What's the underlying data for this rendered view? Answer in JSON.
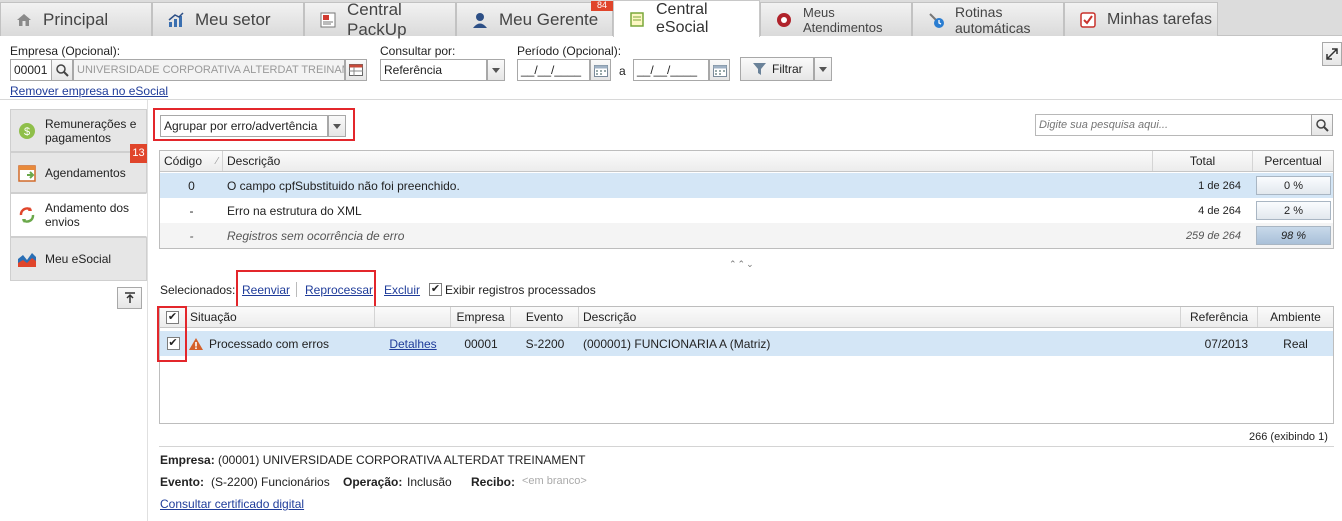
{
  "tabs": [
    {
      "label": "Principal",
      "icon": "home-icon"
    },
    {
      "label": "Meu setor",
      "icon": "chart-icon"
    },
    {
      "label": "Central PackUp",
      "icon": "document-icon"
    },
    {
      "label": "Meu Gerente",
      "icon": "user-icon",
      "badge": "84"
    },
    {
      "label": "Central eSocial",
      "icon": "note-icon",
      "active": true
    },
    {
      "label": "Meus Atendimentos",
      "icon": "support-icon"
    },
    {
      "label": "Rotinas automáticas",
      "icon": "gear-clock-icon"
    },
    {
      "label": "Minhas tarefas",
      "icon": "checklist-icon"
    }
  ],
  "filters": {
    "empresa_label": "Empresa (Opcional):",
    "empresa_code": "00001",
    "empresa_name": "UNIVERSIDADE CORPORATIVA ALTERDAT TREINAMENT",
    "consultar_label": "Consultar por:",
    "consultar_value": "Referência",
    "periodo_label": "Período (Opcional):",
    "periodo_from": "__/__/____",
    "periodo_sep": "a",
    "periodo_to": "__/__/____",
    "filtrar_label": "Filtrar",
    "remove_link": "Remover empresa no eSocial"
  },
  "sidebar": {
    "items": [
      {
        "label": "Remunerações e pagamentos",
        "icon": "money-icon"
      },
      {
        "label": "Agendamentos",
        "icon": "calendar-icon"
      },
      {
        "label": "Andamento dos envios",
        "icon": "sync-icon",
        "active": true
      },
      {
        "label": "Meu eSocial",
        "icon": "area-chart-icon"
      }
    ],
    "badge": "13"
  },
  "group": {
    "select_value": "Agrupar por erro/advertência",
    "search_placeholder": "Digite sua pesquisa aqui..."
  },
  "errors_table": {
    "headers": [
      "Código",
      "Descrição",
      "Total",
      "Percentual"
    ],
    "rows": [
      {
        "code": "0",
        "desc": "O campo cpfSubstituido não foi preenchido.",
        "total": "1 de 264",
        "pct": "0 %"
      },
      {
        "code": "-",
        "desc": "Erro na estrutura do XML",
        "total": "4 de 264",
        "pct": "2 %"
      },
      {
        "code": "-",
        "desc": "Registros sem ocorrência de erro",
        "total": "259 de 264",
        "pct": "98 %"
      }
    ]
  },
  "collapse_toggle": "⌃⌃⌄",
  "actions": {
    "selecionados": "Selecionados:",
    "reenviar": "Reenviar",
    "reprocessar": "Reprocessar",
    "excluir": "Excluir",
    "exibir": "Exibir registros processados"
  },
  "events_table": {
    "headers": [
      "Situação",
      "Empresa",
      "Evento",
      "Descrição",
      "Referência",
      "Ambiente"
    ],
    "rows": [
      {
        "situacao": "Processado com erros",
        "detalhes": "Detalhes",
        "empresa": "00001",
        "evento": "S-2200",
        "desc": "(000001) FUNCIONARIA A (Matriz)",
        "ref": "07/2013",
        "amb": "Real"
      }
    ]
  },
  "count_text": "266 (exibindo 1)",
  "details": {
    "empresa_label": "Empresa:",
    "empresa_value": "(00001) UNIVERSIDADE CORPORATIVA ALTERDAT TREINAMENT",
    "evento_label": "Evento:",
    "evento_value": "(S-2200) Funcionários",
    "operacao_label": "Operação:",
    "operacao_value": "Inclusão",
    "recibo_label": "Recibo:",
    "recibo_value": "<em branco>",
    "cert_link": "Consultar certificado digital"
  },
  "colors": {
    "accent_red": "#e3262b",
    "link": "#1f3c9a",
    "selected_row": "#d4e6f6"
  }
}
